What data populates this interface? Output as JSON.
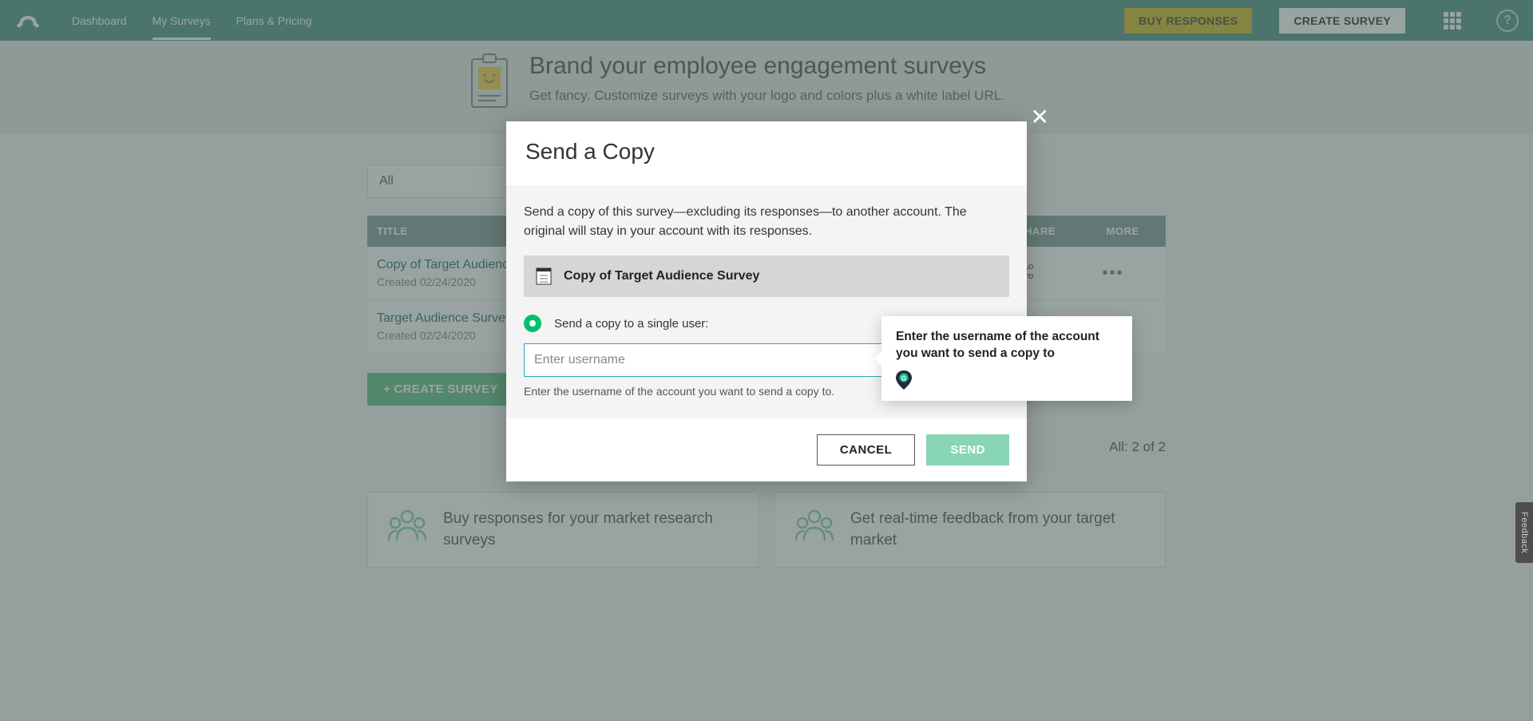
{
  "header": {
    "nav": {
      "dashboard": "Dashboard",
      "my_surveys": "My Surveys",
      "plans": "Plans & Pricing"
    },
    "buy": "BUY RESPONSES",
    "create": "CREATE SURVEY"
  },
  "promo": {
    "title": "Brand your employee engagement surveys",
    "text": "Get fancy. Customize surveys with your logo and colors plus a white label URL."
  },
  "filter": "All",
  "table": {
    "cols": {
      "title": "TITLE",
      "share": "SHARE",
      "more": "MORE"
    },
    "rows": [
      {
        "title": "Copy of Target Audience Survey",
        "meta": "Created 02/24/2020"
      },
      {
        "title": "Target Audience Survey",
        "meta": "Created 02/24/2020"
      }
    ]
  },
  "create_survey": "+ CREATE SURVEY",
  "count": "All: 2 of 2",
  "cards": {
    "left": "Buy responses for your market research surveys",
    "right": "Get real-time feedback from your target market"
  },
  "modal": {
    "title": "Send a Copy",
    "desc": "Send a copy of this survey—excluding its responses—to another account. The original will stay in your account with its responses.",
    "survey": "Copy of Target Audience Survey",
    "radio": "Send a copy to a single user:",
    "placeholder": "Enter username",
    "hint": "Enter the username of the account you want to send a copy to.",
    "cancel": "CANCEL",
    "send": "SEND"
  },
  "tooltip": "Enter the username of the account you want to send a copy to",
  "feedback": "Feedback"
}
